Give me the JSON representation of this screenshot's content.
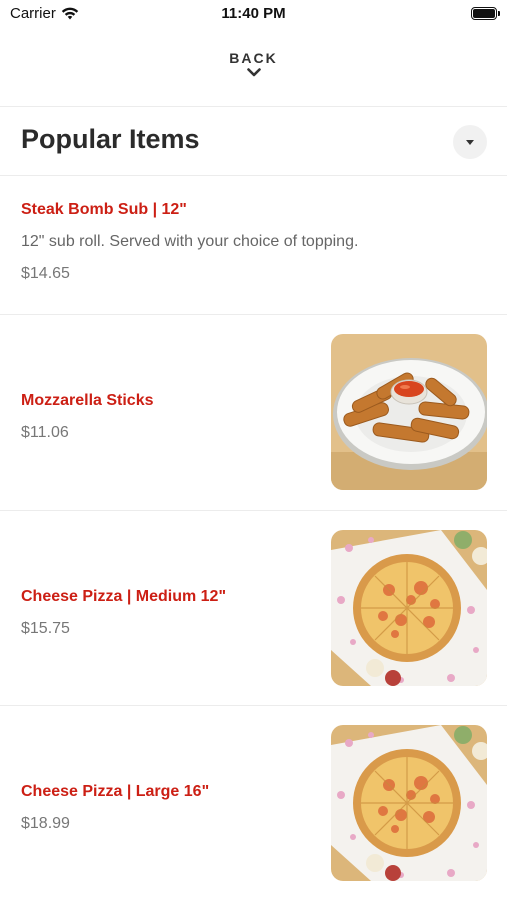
{
  "status_bar": {
    "carrier": "Carrier",
    "time": "11:40 PM",
    "icons": [
      "wifi-icon",
      "battery-icon"
    ]
  },
  "nav": {
    "back_label": "BACK",
    "back_icon": "chevron-down-icon"
  },
  "section": {
    "title": "Popular Items",
    "toggle_icon": "caret-down-icon"
  },
  "colors": {
    "accent": "#cc1f14",
    "text_muted": "#777777",
    "divider": "#ececec"
  },
  "items": [
    {
      "name": "Steak Bomb Sub | 12\"",
      "description": "12\" sub roll. Served with your choice of topping.",
      "price": "$14.65",
      "image": "none"
    },
    {
      "name": "Mozzarella Sticks",
      "description": "",
      "price": "$11.06",
      "image": "mozzarella-sticks-photo"
    },
    {
      "name": "Cheese Pizza | Medium 12\"",
      "description": "",
      "price": "$15.75",
      "image": "cheese-pizza-photo"
    },
    {
      "name": "Cheese Pizza | Large 16\"",
      "description": "",
      "price": "$18.99",
      "image": "cheese-pizza-photo"
    }
  ]
}
